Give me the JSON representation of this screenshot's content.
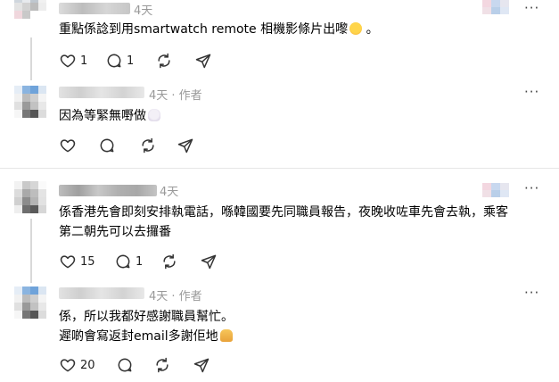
{
  "posts": [
    {
      "time": "4天",
      "text_lines": [
        "重點係諗到用smartwatch remote 相機影條片出嚟",
        "。"
      ],
      "emoji": "laughing-emoji",
      "likes": "1",
      "replies": "1",
      "more": "···"
    },
    {
      "time": "4天 · 作者",
      "text_lines": [
        "因為等緊無嘢做"
      ],
      "emoji": "skull-emoji",
      "likes": "",
      "replies": "",
      "more": "···"
    },
    {
      "time": "4天",
      "text_lines": [
        "係香港先會即刻安排執電話，喺韓國要先同職員報告，夜晚收咗車先會去執，乘客",
        "第二朝先可以去攞番"
      ],
      "likes": "15",
      "replies": "1",
      "more": "···"
    },
    {
      "time": "4天 · 作者",
      "text_lines": [
        "係，所以我都好感謝職員幫忙。",
        "遲啲會寫返封email多謝佢地"
      ],
      "emoji": "praying-hands-emoji",
      "likes": "20",
      "replies": "",
      "more": "···"
    }
  ],
  "colors": {
    "line": "#d9d9d9",
    "meta": "#999999",
    "icon": "#333333"
  }
}
